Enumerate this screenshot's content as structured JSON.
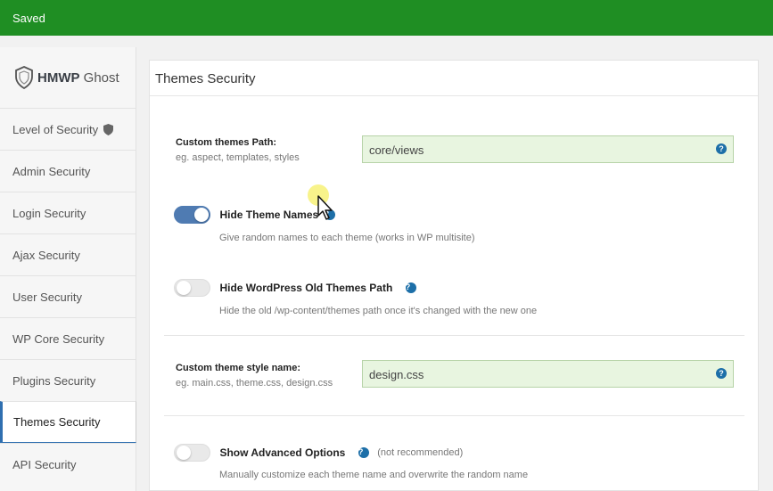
{
  "notice": {
    "text": "Saved",
    "color": "#1f8e23"
  },
  "brand": {
    "strong": "HMWP",
    "light": "Ghost",
    "logo_icon": "ghost-shield-icon"
  },
  "sidebar": {
    "items": [
      {
        "label": "Level of Security",
        "icon": "shield-icon"
      },
      {
        "label": "Admin Security"
      },
      {
        "label": "Login Security"
      },
      {
        "label": "Ajax Security"
      },
      {
        "label": "User Security"
      },
      {
        "label": "WP Core Security"
      },
      {
        "label": "Plugins Security"
      },
      {
        "label": "Themes Security",
        "active": true
      },
      {
        "label": "API Security"
      }
    ],
    "active_color": "#2f6fb0"
  },
  "panel": {
    "title": "Themes Security",
    "themes_path": {
      "label": "Custom themes Path:",
      "sub": "eg. aspect, templates, styles",
      "value": "core/views",
      "help_glyph": "?"
    },
    "hide_theme_names": {
      "label": "Hide Theme Names",
      "desc": "Give random names to each theme (works in WP multisite)",
      "enabled": true,
      "help_glyph": "?"
    },
    "hide_old_path": {
      "label": "Hide WordPress Old Themes Path",
      "desc": "Hide the old /wp-content/themes path once it's changed with the new one",
      "enabled": false,
      "help_glyph": "?"
    },
    "style_name": {
      "label": "Custom theme style name:",
      "sub": "eg. main.css, theme.css, design.css",
      "value": "design.css",
      "help_glyph": "?"
    },
    "advanced": {
      "label": "Show Advanced Options",
      "note": "(not recommended)",
      "desc": "Manually customize each theme name and overwrite the random name",
      "enabled": false,
      "help_glyph": "?"
    }
  },
  "colors": {
    "field_bg": "#e8f5e0",
    "toggle_on": "#4f7bb2",
    "help_icon": "#1d6fa8"
  }
}
